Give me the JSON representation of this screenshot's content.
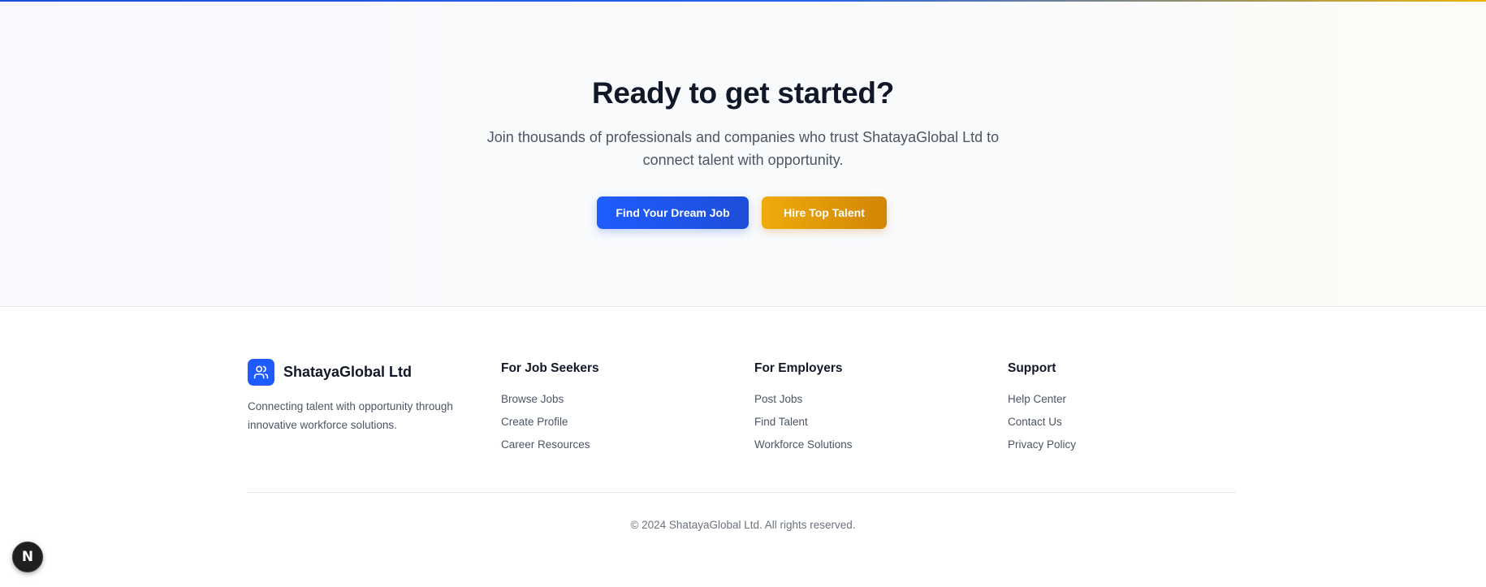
{
  "cta": {
    "title": "Ready to get started?",
    "subtitle": "Join thousands of professionals and companies who trust ShatayaGlobal Ltd to connect talent with opportunity.",
    "primary_button": "Find Your Dream Job",
    "secondary_button": "Hire Top Talent"
  },
  "footer": {
    "brand": {
      "name": "ShatayaGlobal Ltd",
      "icon": "users-icon",
      "description": "Connecting talent with opportunity through innovative workforce solutions."
    },
    "columns": [
      {
        "title": "For Job Seekers",
        "links": [
          "Browse Jobs",
          "Create Profile",
          "Career Resources"
        ]
      },
      {
        "title": "For Employers",
        "links": [
          "Post Jobs",
          "Find Talent",
          "Workforce Solutions"
        ]
      },
      {
        "title": "Support",
        "links": [
          "Help Center",
          "Contact Us",
          "Privacy Policy"
        ]
      }
    ],
    "copyright": "© 2024 ShatayaGlobal Ltd. All rights reserved."
  },
  "dev_badge": {
    "label": "N",
    "icon": "nextjs-icon"
  },
  "colors": {
    "primary": "#1f5cff",
    "accent": "#e5a00d",
    "heading": "#111827",
    "body_text": "#4b5563"
  }
}
